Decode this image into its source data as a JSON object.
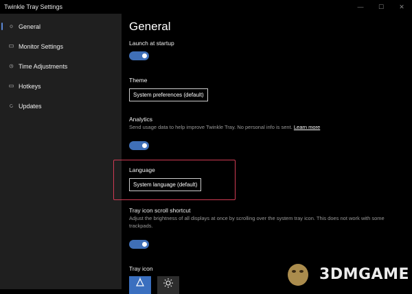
{
  "window": {
    "title": "Twinkle Tray Settings",
    "minimize_glyph": "—",
    "maximize_glyph": "☐",
    "close_glyph": "✕"
  },
  "sidebar": {
    "items": [
      {
        "label": "General",
        "active": true
      },
      {
        "label": "Monitor Settings",
        "active": false
      },
      {
        "label": "Time Adjustments",
        "active": false
      },
      {
        "label": "Hotkeys",
        "active": false
      },
      {
        "label": "Updates",
        "active": false
      }
    ]
  },
  "page": {
    "title": "General"
  },
  "sections": {
    "startup": {
      "label": "Launch at startup",
      "toggle_on": true
    },
    "theme": {
      "label": "Theme",
      "value": "System preferences (default)"
    },
    "analytics": {
      "label": "Analytics",
      "desc": "Send usage data to help improve Twinkle Tray. No personal info is sent.",
      "link": "Learn more",
      "toggle_on": true
    },
    "language": {
      "label": "Language",
      "value": "System language (default)"
    },
    "scroll": {
      "label": "Tray icon scroll shortcut",
      "desc": "Adjust the brightness of all displays at once by scrolling over the system tray icon. This does not work with some trackpads.",
      "toggle_on": true
    },
    "trayicon": {
      "label": "Tray icon",
      "options": [
        {
          "name": "default-tray-icon",
          "selected": true
        },
        {
          "name": "sun-tray-icon",
          "selected": false
        }
      ]
    }
  },
  "colors": {
    "accent": "#3f6fb7",
    "highlight_border": "#d23b54",
    "sidebar_bg": "#1f1f1f"
  },
  "watermark": {
    "text": "3DMGAME"
  }
}
